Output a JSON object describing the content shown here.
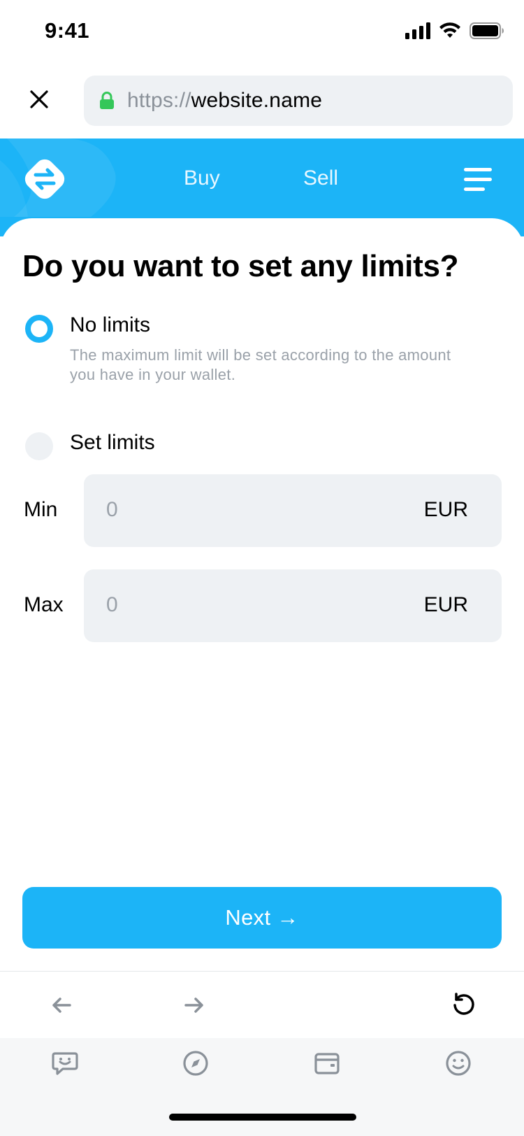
{
  "status_bar": {
    "time": "9:41",
    "icons": [
      "signal-icon",
      "wifi-icon",
      "battery-icon"
    ]
  },
  "browser": {
    "close_icon": "close-icon",
    "lock_icon": "lock-icon",
    "url_scheme": "https://",
    "url_host": "website.name"
  },
  "header": {
    "logo_icon": "swap-arrows-icon",
    "nav": {
      "buy": "Buy",
      "sell": "Sell"
    },
    "menu_icon": "hamburger-menu-icon",
    "brand_color": "#1cb4f7"
  },
  "form": {
    "title": "Do you want to set any limits?",
    "options": [
      {
        "label": "No limits",
        "description": "The maximum limit will be set according to the amount you have in your wallet.",
        "selected": true
      },
      {
        "label": "Set limits",
        "selected": false
      }
    ],
    "min": {
      "label": "Min",
      "value": "0",
      "currency": "EUR"
    },
    "max": {
      "label": "Max",
      "value": "0",
      "currency": "EUR"
    },
    "next_button": "Next →"
  },
  "browser_nav": {
    "icons": [
      "back-arrow-icon",
      "forward-arrow-icon",
      "reload-icon"
    ]
  },
  "tab_bar": {
    "icons": [
      "chat-icon",
      "compass-icon",
      "wallet-icon",
      "smiley-icon"
    ]
  },
  "colors": {
    "accent": "#1cb4f7",
    "input_bg": "#eef1f4",
    "muted_text": "#9aa1a9"
  }
}
